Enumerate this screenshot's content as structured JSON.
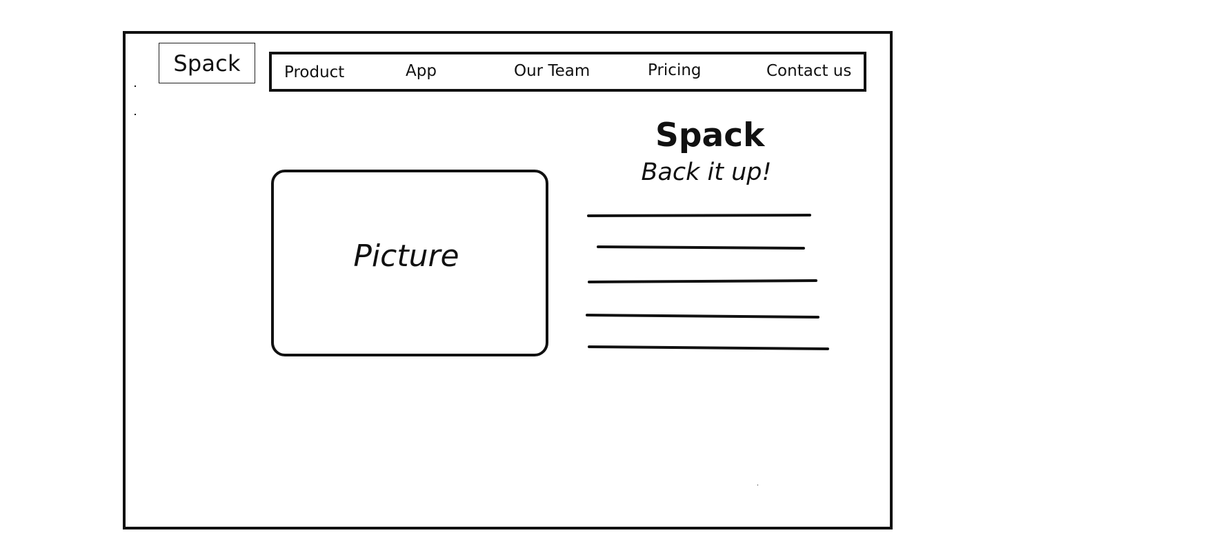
{
  "brand": {
    "logo_text": "Spack"
  },
  "nav": {
    "items": [
      {
        "label": "Product"
      },
      {
        "label": "App"
      },
      {
        "label": "Our Team"
      },
      {
        "label": "Pricing"
      },
      {
        "label": "Contact us"
      }
    ]
  },
  "hero": {
    "picture_label": "Picture",
    "title": "Spack",
    "subtitle": "Back it up!"
  },
  "colors": {
    "ink": "#111111",
    "background": "#ffffff"
  }
}
